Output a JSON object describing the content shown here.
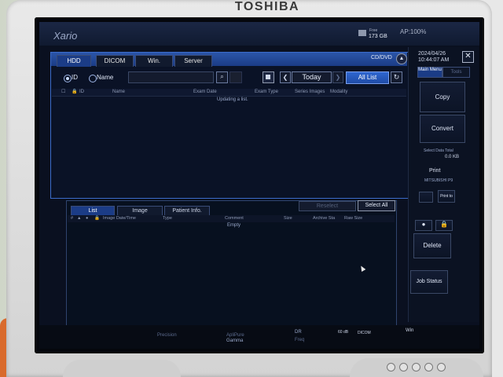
{
  "device": {
    "brand": "TOSHIBA"
  },
  "header": {
    "app_name": "Xario",
    "free_label": "Free",
    "free_value": "173 GB",
    "ap_label": "AP:100%"
  },
  "tabs": [
    {
      "label": "HDD",
      "active": true
    },
    {
      "label": "DICOM",
      "active": false
    },
    {
      "label": "Win.",
      "active": false
    },
    {
      "label": "Server",
      "active": false
    }
  ],
  "media_label": "CD/DVD",
  "search": {
    "radio_id": "ID",
    "radio_name": "Name",
    "selected": "ID",
    "value": "",
    "today_label": "Today",
    "all_list_label": "All List"
  },
  "exam_columns": [
    "ID",
    "Name",
    "Exam Date",
    "Exam Type",
    "Series Images",
    "Modality"
  ],
  "exam_status": "Updating a list.",
  "bottom": {
    "reselect_label": "Reselect",
    "select_all_label": "Select All",
    "tabs": [
      {
        "label": "List",
        "active": true
      },
      {
        "label": "Image",
        "active": false
      },
      {
        "label": "Patient Info.",
        "active": false
      }
    ],
    "columns": [
      "Image Date/Time",
      "Type",
      "Comment",
      "Size",
      "Archive Sta",
      "Raw Size"
    ],
    "empty_text": "Empty"
  },
  "sidebar": {
    "date": "2024/04/26",
    "time": "10:44:07 AM",
    "tab_main": "Main Menu",
    "tab_tools": "Tools",
    "copy_label": "Copy",
    "convert_label": "Convert",
    "select_total_label": "Select Data Total",
    "select_total_value": "0.0 KB",
    "print_label": "Print",
    "printer_name": "MITSUBISHI P9",
    "print_to_label": "Print to",
    "delete_label": "Delete",
    "job_status_label": "Job Status"
  },
  "statusbar": {
    "precision_label": "Precision",
    "aplpure_label": "ApliPure",
    "gamma_label": "Gamma",
    "dr_label": "DR",
    "freq_label": "Freq",
    "db_value": "60 dB",
    "dicom_label": "DICOM",
    "win_label": "Win"
  },
  "colors": {
    "accent": "#2f67d0",
    "panel_border": "#3b6bc9",
    "screen_bg": "#0a1020"
  }
}
